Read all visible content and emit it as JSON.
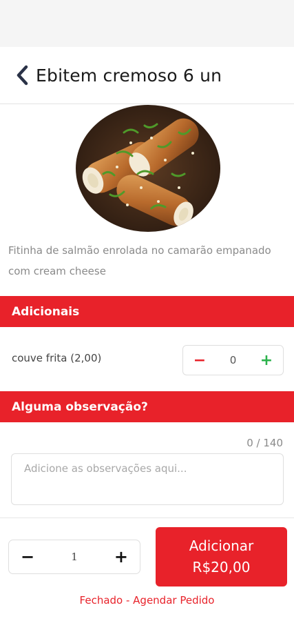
{
  "header": {
    "title": "Ebitem cremoso 6 un",
    "back_icon": "chevron-left-icon"
  },
  "product": {
    "image": "sushi-rolls-photo",
    "description": "Fitinha de salmão enrolada no camarão empanado com cream cheese"
  },
  "addons": {
    "section_title": "Adicionais",
    "items": [
      {
        "label": "couve frita (2,00)",
        "quantity": "0",
        "minus_symbol": "−",
        "plus_symbol": "+"
      }
    ]
  },
  "observation": {
    "section_title": "Alguma observação?",
    "char_counter": "0 / 140",
    "placeholder": "Adicione as observações aqui...",
    "value": ""
  },
  "footer": {
    "quantity": "1",
    "minus_symbol": "−",
    "plus_symbol": "+",
    "add_label": "Adicionar",
    "add_price": "R$20,00",
    "status_link": "Fechado - Agendar Pedido"
  },
  "colors": {
    "accent": "#e8222a",
    "plus_green": "#2bb24c",
    "title": "#1a1a1a"
  }
}
